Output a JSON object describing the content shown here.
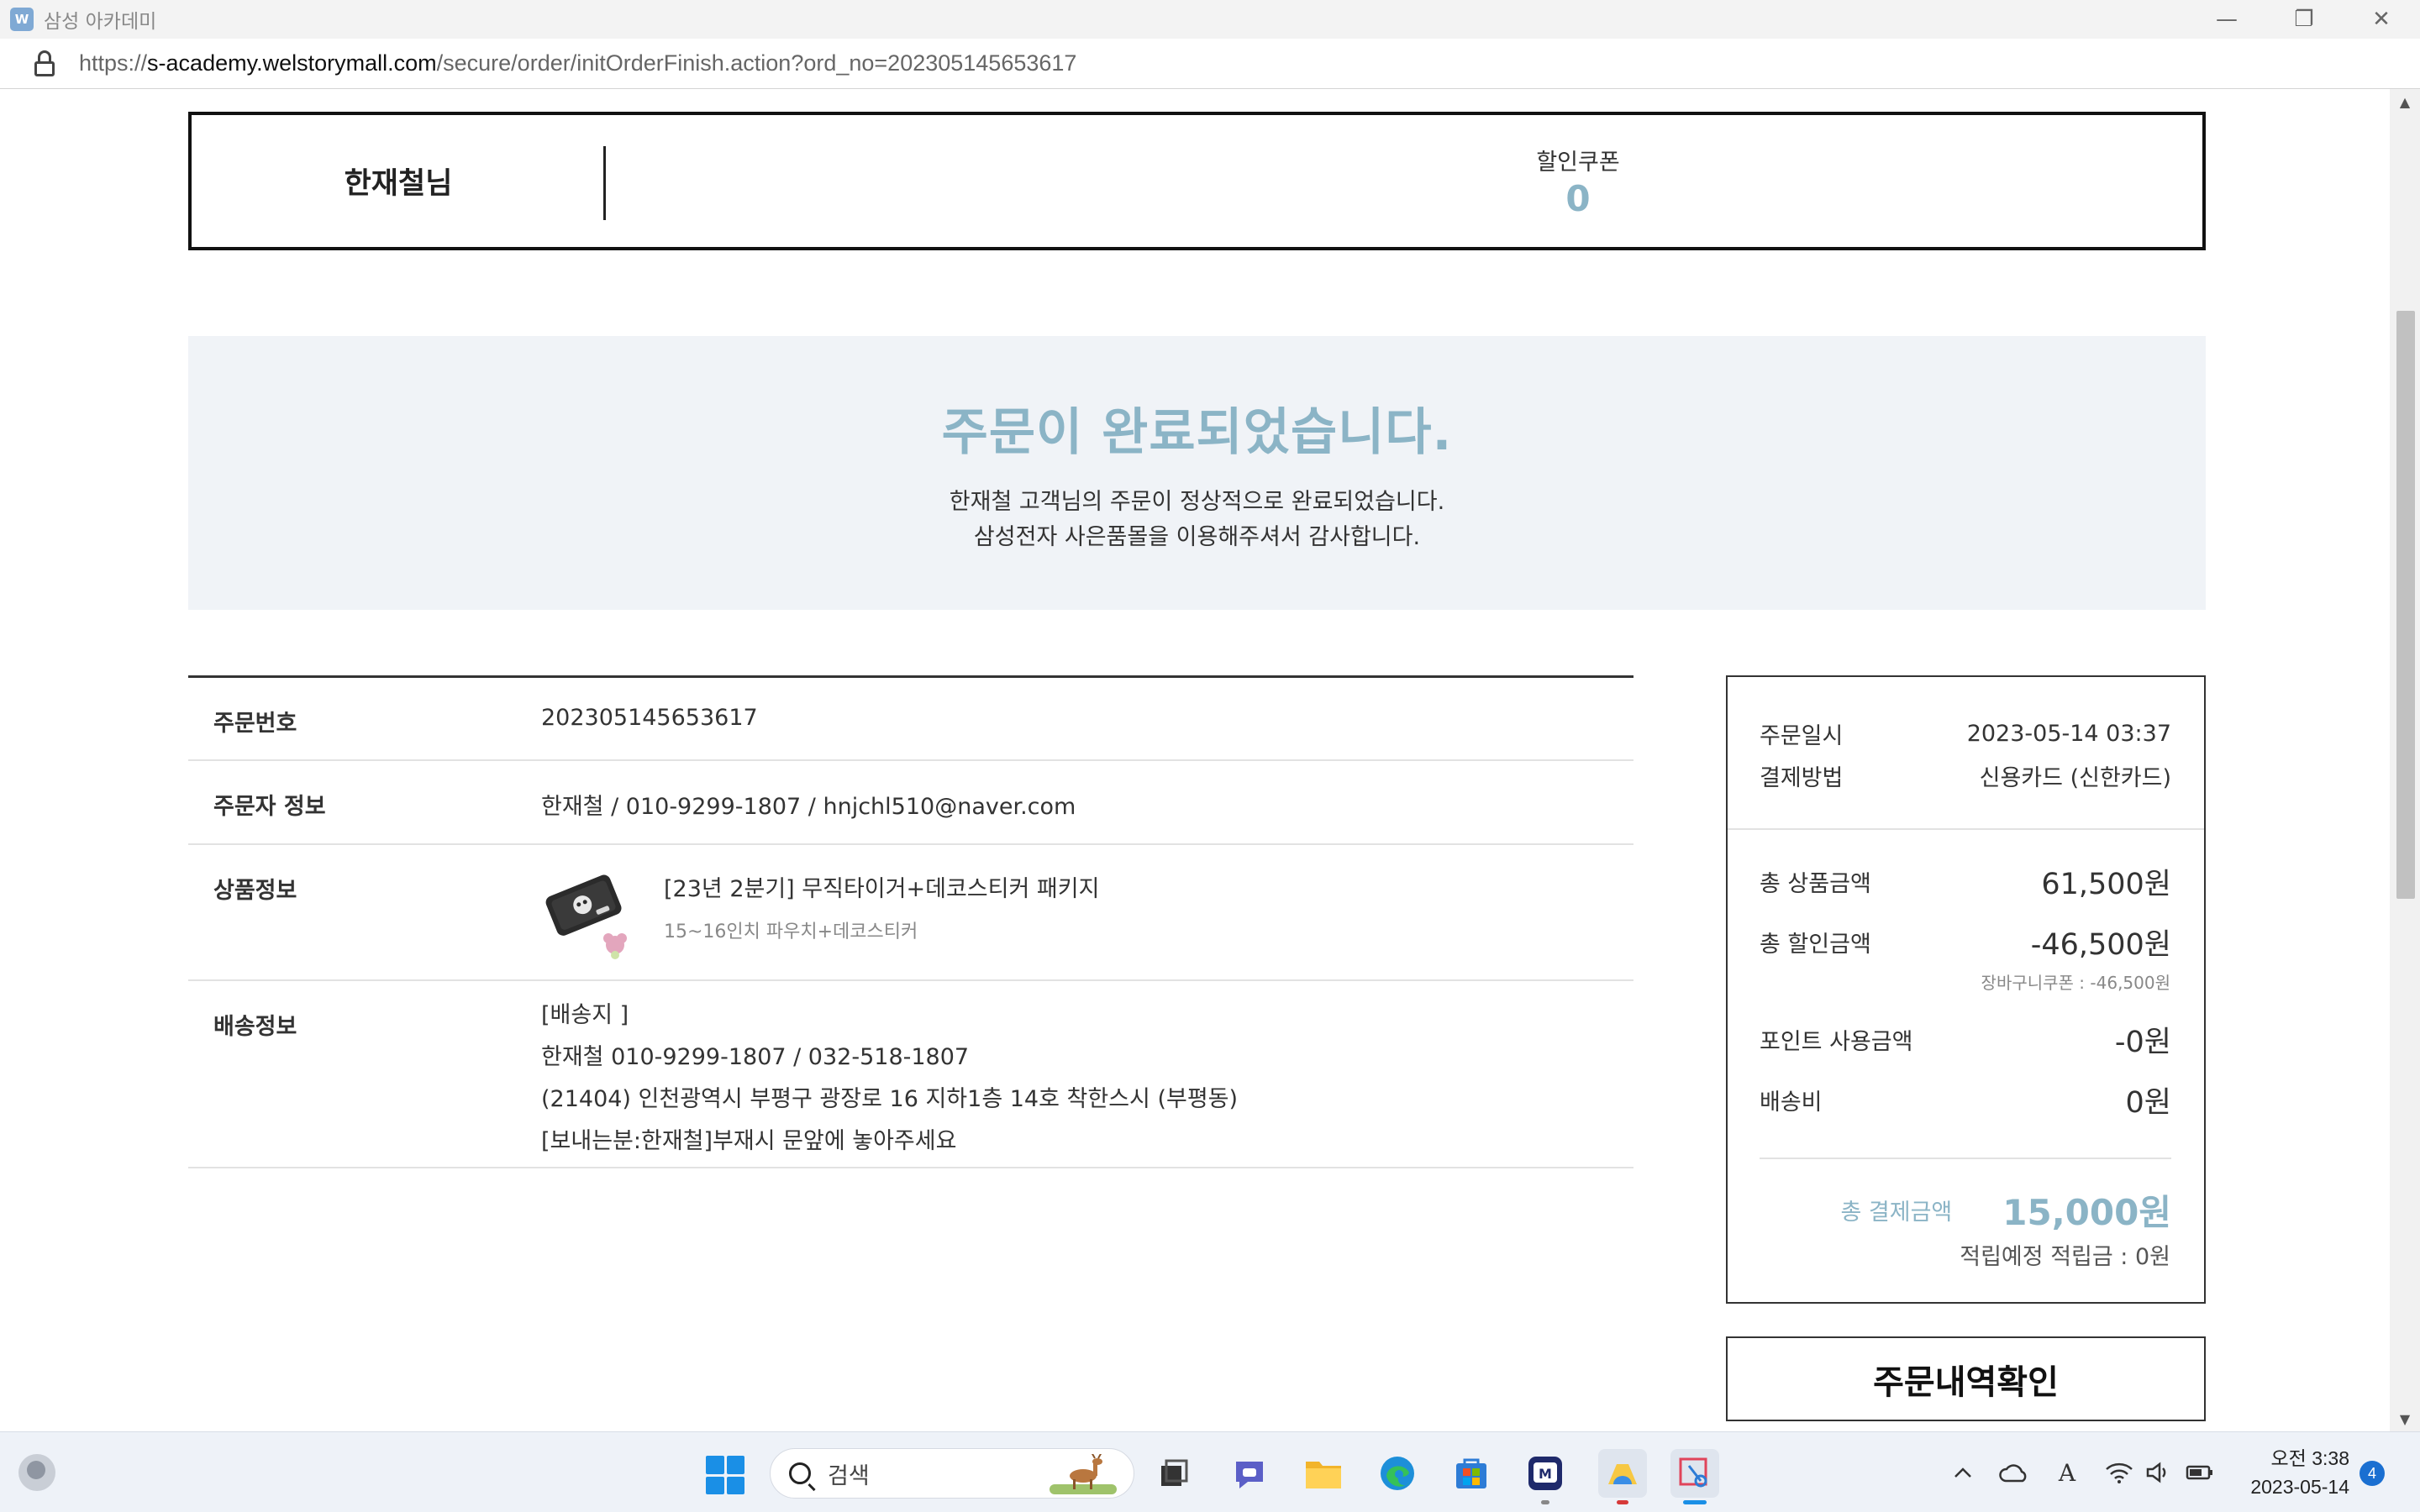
{
  "window": {
    "title": "삼성 아카데미",
    "app_icon_text": "W",
    "controls": [
      "—",
      "❐",
      "✕"
    ]
  },
  "addressbar": {
    "url_scheme": "https://",
    "url_host": "s-academy.welstorymall.com",
    "url_path": "/secure/order/initOrderFinish.action?ord_no=202305145653617"
  },
  "user_box": {
    "name": "한재철님",
    "coupon_label": "할인쿠폰",
    "coupon_count": "0"
  },
  "banner": {
    "title": "주문이 완료되었습니다.",
    "message_line1": "한재철 고객님의 주문이 정상적으로 완료되었습니다.",
    "message_line2": "삼성전자 사은품몰을 이용해주셔서 감사합니다."
  },
  "order_info": {
    "order_no_label": "주문번호",
    "order_no": "202305145653617",
    "buyer_label": "주문자 정보",
    "buyer": "한재철  / 010-9299-1807  / hnjchl510@naver.com",
    "product_label": "상품정보",
    "product_name": "[23년 2분기] 무직타이거+데코스티커 패키지",
    "product_option": "15~16인치 파우치+데코스티커",
    "shipping_label": "배송정보",
    "shipping_lines": [
      "[배송지 ]",
      "한재철 010-9299-1807 / 032-518-1807",
      "(21404) 인천광역시 부평구 광장로 16 지하1층 14호 착한스시 (부평동)",
      "[보내는분:한재철]부재시 문앞에 놓아주세요"
    ]
  },
  "summary": {
    "order_date_label": "주문일시",
    "order_date": "2023-05-14 03:37",
    "payment_label": "결제방법",
    "payment": "신용카드 (신한카드)",
    "total_goods_label": "총 상품금액",
    "total_goods": "61,500원",
    "total_discount_label": "총 할인금액",
    "total_discount": "-46,500원",
    "discount_detail": "장바구니쿠폰 : -46,500원",
    "points_used_label": "포인트 사용금액",
    "points_used": "-0원",
    "shipping_fee_label": "배송비",
    "shipping_fee": "0원",
    "grand_total_label": "총 결제금액",
    "grand_total": "15,000원",
    "reward_note": "적립예정 적립금 : 0원"
  },
  "history_button": "주문내역확인",
  "taskbar": {
    "search_placeholder": "검색",
    "clock_time": "오전 3:38",
    "clock_date": "2023-05-14",
    "notification_count": "4"
  },
  "colors": {
    "accent": "#8bb4c6",
    "banner_bg": "#f0f3f7",
    "taskbar_bg": "#eef2f8"
  }
}
